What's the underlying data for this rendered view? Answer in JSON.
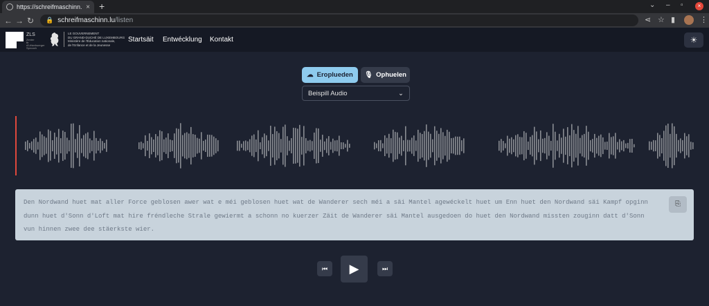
{
  "browser": {
    "tab_title": "https://schreifmaschinn.lu",
    "tab_close": "×",
    "new_tab": "+",
    "url_host": "schreifmaschinn.lu",
    "url_path": "/listen",
    "back": "←",
    "forward": "→",
    "reload": "↻",
    "lock": "🔒",
    "tab_menu": "⌄",
    "minimize": "–",
    "restore": "▫",
    "close": "×",
    "share": "⋖",
    "star": "☆",
    "sidepanel": "▮",
    "kebab": "⋮"
  },
  "app": {
    "logo_text": "ZLS",
    "logo_sub": "Zenter fir d'Lëtzebuerger Sprooch",
    "gov_lines": [
      "LE GOUVERNEMENT",
      "DU GRAND-DUCHÉ DE LUXEMBOURG",
      "Ministère de l'Éducation nationale,",
      "de l'Enfance et de la Jeunesse"
    ],
    "menu": [
      "Startsäit",
      "Entwécklung",
      "Kontakt"
    ],
    "theme_icon": "☀"
  },
  "controls": {
    "upload_label": "Eroplueden",
    "upload_icon": "☁",
    "record_label": "Ophuelen",
    "record_icon": "🎙",
    "select_value": "Beispill Audio",
    "select_chevron": "⌄"
  },
  "waveform": {
    "playhead_color": "#e0483c",
    "bar_color": "#8a8d93"
  },
  "transcript": {
    "text": "Den Nordwand huet mat aller Force geblosen awer wat e méi geblosen huet wat de Wanderer sech méi a säi Mantel agewéckelt huet um Enn huet den Nordwand säi Kampf opginn dunn huet d'Sonn d'Loft mat hire fréndleche Strale gewiermt a schonn no kuerzer Zäit de Wanderer säi Mantel ausgedoen do huet den Nordwand missten zouginn datt d'Sonn vun hinnen zwee dee stäerkste wier.",
    "copy_icon": "⎘"
  },
  "player": {
    "prev_icon": "⏮",
    "play_icon": "▶",
    "next_icon": "⏭"
  }
}
